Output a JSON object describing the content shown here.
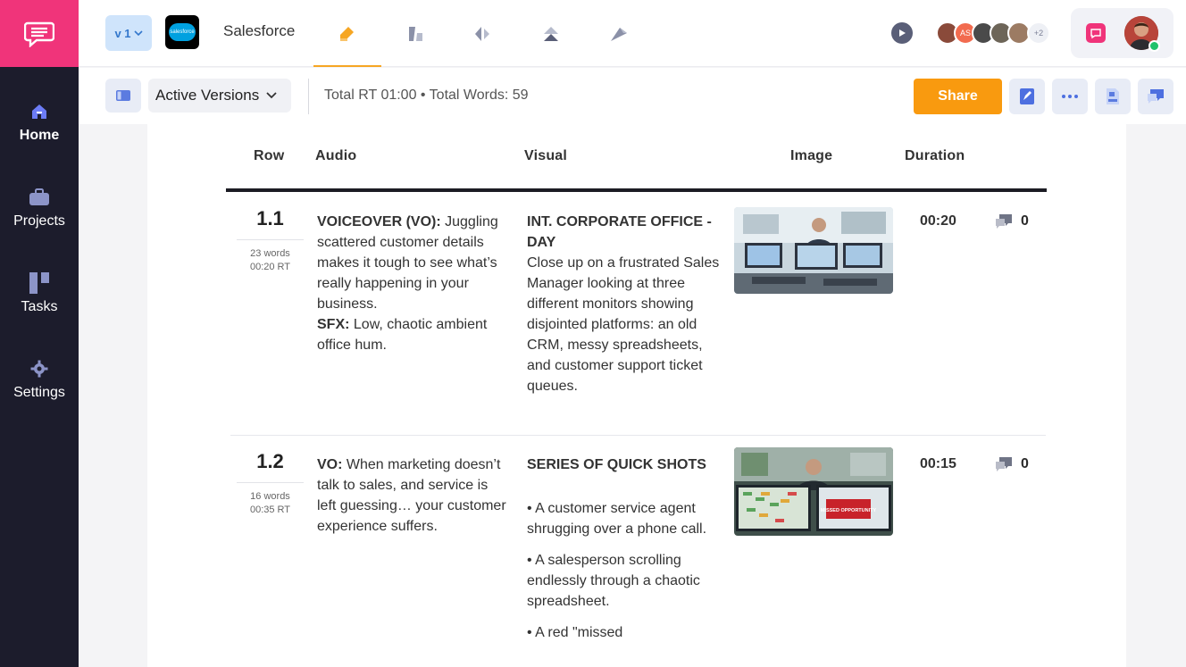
{
  "sidebar": {
    "logo_icon": "chat-bubble-icon",
    "items": [
      {
        "label": "Home",
        "icon": "home-icon",
        "active": true
      },
      {
        "label": "Projects",
        "icon": "briefcase-icon"
      },
      {
        "label": "Tasks",
        "icon": "tasks-icon"
      },
      {
        "label": "Settings",
        "icon": "gear-icon"
      }
    ]
  },
  "topbar": {
    "version": "v 1",
    "brand_logo_text": "salesforce",
    "project_name": "Salesforce",
    "avatar_initials": "AS",
    "avatar_more": "+2"
  },
  "toolbar": {
    "versions_label": "Active Versions",
    "stats": "Total RT 01:00 • Total Words: 59",
    "share_label": "Share"
  },
  "table": {
    "headers": {
      "row": "Row",
      "audio": "Audio",
      "visual": "Visual",
      "image": "Image",
      "duration": "Duration"
    },
    "rows": [
      {
        "num": "1.1",
        "words": "23 words",
        "rt": "00:20 RT",
        "audio_bold1": "VOICEOVER (VO):",
        "audio_text1": " Juggling scattered customer details makes it tough to see what’s really happening in your business.",
        "audio_bold2": "SFX:",
        "audio_text2": " Low, chaotic ambient office hum.",
        "visual_heading": "INT. CORPORATE OFFICE - DAY",
        "visual_text": "Close up on a frustrated Sales Manager looking at three different monitors showing disjointed platforms: an old CRM, messy spreadsheets, and customer support ticket queues.",
        "duration": "00:20",
        "comments": "0"
      },
      {
        "num": "1.2",
        "words": "16 words",
        "rt": "00:35 RT",
        "audio_bold1": "VO:",
        "audio_text1": " When marketing doesn’t talk to sales, and service is left guessing… your customer experience suffers.",
        "visual_heading": "SERIES OF QUICK SHOTS",
        "bullets": [
          "• A customer service agent shrugging over a phone call.",
          "• A salesperson scrolling endlessly through a chaotic spreadsheet.",
          "• A red \"missed"
        ],
        "image_sign": "MISSED OPPORTUNITY",
        "duration": "00:15",
        "comments": "0"
      }
    ]
  }
}
